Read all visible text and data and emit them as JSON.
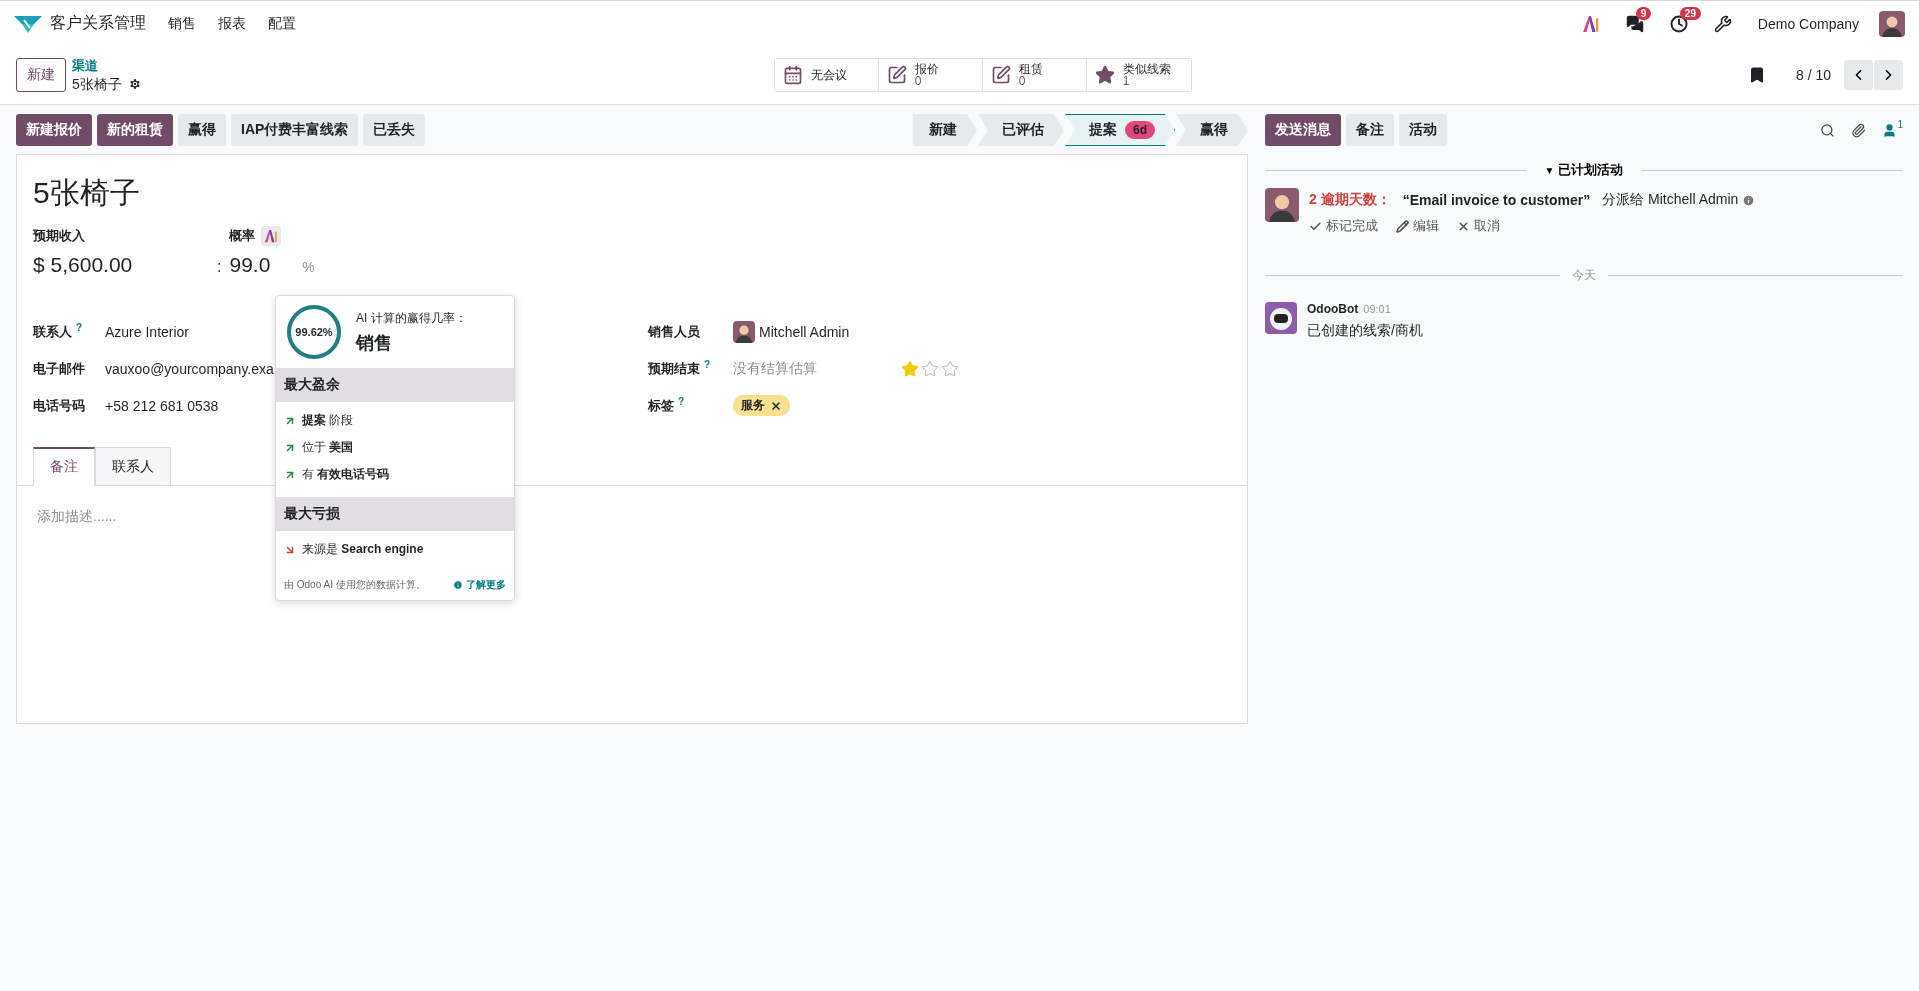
{
  "navbar": {
    "app_name": "客户关系管理",
    "menu": [
      "销售",
      "报表",
      "配置"
    ],
    "message_count": "9",
    "activity_count": "29",
    "company": "Demo Company"
  },
  "control_panel": {
    "new_button": "新建",
    "breadcrumb_parent": "渠道",
    "record_name": "5张椅子",
    "pager": "8 / 10",
    "stat_buttons": [
      {
        "kind": "calendar",
        "label": "无会议"
      },
      {
        "kind": "edit",
        "label": "报价",
        "value": "0"
      },
      {
        "kind": "edit",
        "label": "租赁",
        "value": "0"
      },
      {
        "kind": "star",
        "label": "类似线索",
        "value": "1"
      }
    ]
  },
  "action_buttons": [
    {
      "label": "新建报价",
      "primary": true
    },
    {
      "label": "新的租赁",
      "primary": true
    },
    {
      "label": "赢得",
      "primary": false
    },
    {
      "label": "IAP付费丰富线索",
      "primary": false
    },
    {
      "label": "已丢失",
      "primary": false
    }
  ],
  "stages": [
    {
      "label": "新建",
      "selected": false
    },
    {
      "label": "已评估",
      "selected": false
    },
    {
      "label": "提案",
      "selected": true,
      "badge": "6d"
    },
    {
      "label": "赢得",
      "selected": false
    }
  ],
  "chatter_buttons": [
    {
      "label": "发送消息",
      "primary": true
    },
    {
      "label": "备注",
      "primary": false
    },
    {
      "label": "活动",
      "primary": false
    }
  ],
  "follower_count": "1",
  "form": {
    "title": "5张椅子",
    "revenue_label": "预期收入",
    "revenue": "$ 5,600.00",
    "probability_label": "概率",
    "probability_prefix": ":",
    "probability": "99.0",
    "probability_suffix": "%",
    "left_fields": [
      {
        "label": "联系人",
        "help": "?",
        "value": "Azure Interior"
      },
      {
        "label": "电子邮件",
        "value": "vauxoo@yourcompany.exa"
      },
      {
        "label": "电话号码",
        "value": "+58 212 681 0538"
      }
    ],
    "right_fields": [
      {
        "kind": "user",
        "label": "销售人员",
        "value": "Mitchell Admin"
      },
      {
        "kind": "date",
        "label": "预期结束",
        "help": "?",
        "placeholder": "没有结算估算",
        "stars": 1
      },
      {
        "kind": "tags",
        "label": "标签",
        "help": "?",
        "tags": [
          "服务"
        ]
      }
    ],
    "tabs": [
      {
        "label": "备注",
        "selected": true
      },
      {
        "label": "联系人",
        "selected": false
      }
    ],
    "description_placeholder": "添加描述......"
  },
  "ai_popup": {
    "percentage": "99.62%",
    "level": 0.9962,
    "heading": "AI 计算的赢得几率：",
    "stage": "销售",
    "gains_title": "最大盈余",
    "gains": [
      "**提案** 阶段",
      "位于 **美国**",
      "有 **有效电话号码**"
    ],
    "losses_title": "最大亏损",
    "losses": [
      "来源是 **Search engine**"
    ],
    "footer": "由 Odoo AI 使用您的数据计算。",
    "learn_more": "了解更多"
  },
  "chatter": {
    "activities_toggle": "▼",
    "activities_header": "已计划活动",
    "activity": {
      "overdue": "2 逾期天数：",
      "summary": "“Email invoice to customer”",
      "assigned": "分派给 Mitchell Admin",
      "actions": [
        {
          "kind": "check",
          "label": "标记完成"
        },
        {
          "kind": "edit",
          "label": "编辑"
        },
        {
          "kind": "cancel",
          "label": "取消"
        }
      ]
    },
    "today": "今天",
    "messages": [
      {
        "author": "OdooBot",
        "time": "09:01",
        "body": "已创建的线索/商机"
      }
    ]
  }
}
